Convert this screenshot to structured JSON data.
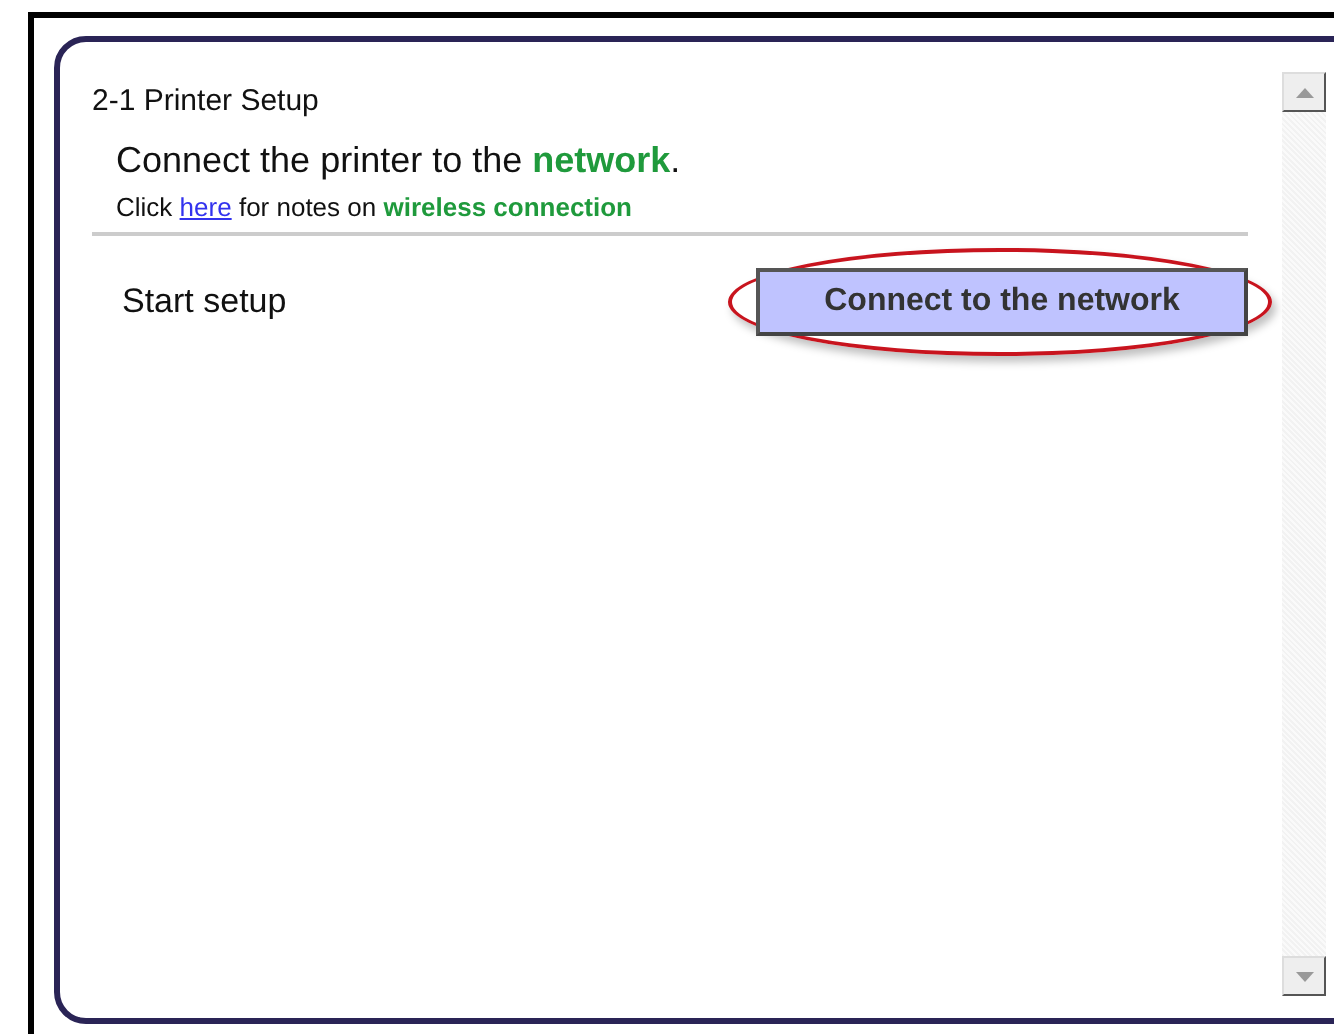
{
  "panel": {
    "title": "2-1 Printer Setup",
    "heading": "Connect the printer to the **network**.",
    "note": {
      "prefix": "Click",
      "link": "here",
      "suffix": "for notes on **wireless connection**"
    },
    "step": {
      "label": "Start setup",
      "button": "Connect to the network",
      "highlighted": true
    }
  }
}
